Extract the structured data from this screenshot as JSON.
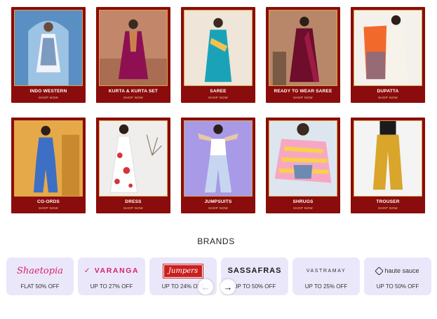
{
  "categories_row1": [
    {
      "label": "INDO WESTERN",
      "shop": "SHOP NOW"
    },
    {
      "label": "KURTA & KURTA SET",
      "shop": "SHOP NOW"
    },
    {
      "label": "SAREE",
      "shop": "SHOP NOW"
    },
    {
      "label": "READY TO WEAR SAREE",
      "shop": "SHOP NOW"
    },
    {
      "label": "DUPATTA",
      "shop": "SHOP NOW"
    }
  ],
  "categories_row2": [
    {
      "label": "CO-ORDS",
      "shop": "SHOP NOW"
    },
    {
      "label": "DRESS",
      "shop": "SHOP NOW"
    },
    {
      "label": "JUMPSUITS",
      "shop": "SHOP NOW"
    },
    {
      "label": "SHRUGS",
      "shop": "SHOP NOW"
    },
    {
      "label": "TROUSER",
      "shop": "SHOP NOW"
    }
  ],
  "brands_section": {
    "title": "BRANDS",
    "items": [
      {
        "logo": "Shaetopia",
        "offer": "FLAT 50% OFF"
      },
      {
        "logo": "VARANGA",
        "offer": "UP TO 27% OFF"
      },
      {
        "logo": "Jumpers",
        "offer": "UP TO 24% OFF"
      },
      {
        "logo": "SASSAFRAS",
        "offer": "UP TO 50% OFF"
      },
      {
        "logo": "VASTRAMAY",
        "offer": "UP TO 25% OFF"
      },
      {
        "logo": "haute sauce",
        "offer": "UP TO 50% OFF"
      }
    ]
  },
  "carousel": {
    "prev_icon": "←",
    "next_icon": "→"
  },
  "colors": {
    "card_bg": "#8a0c0c",
    "card_border": "#e0a23b",
    "brand_bg": "#ebe7fa",
    "brand_accent": "#d6236c"
  }
}
